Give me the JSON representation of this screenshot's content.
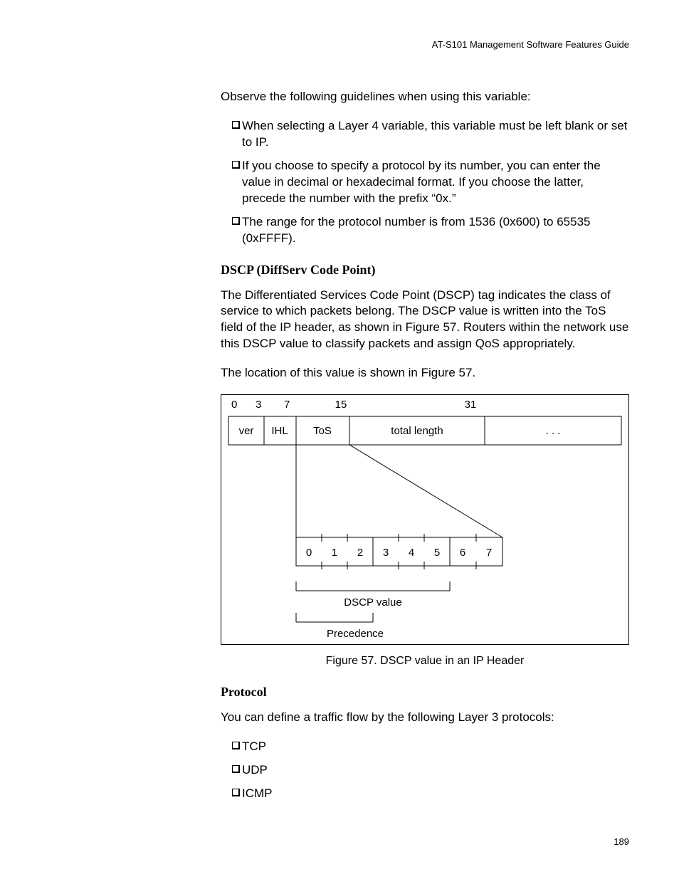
{
  "header": {
    "guide_title": "AT-S101 Management Software Features Guide"
  },
  "intro": "Observe the following guidelines when using this variable:",
  "guidelines": [
    "When selecting a Layer 4 variable, this variable must be left blank or set to IP.",
    "If you choose to specify a protocol by its number, you can enter the value in decimal or hexadecimal format. If you choose the latter, precede the number with the prefix “0x.”",
    "The range for the protocol number is from 1536 (0x600) to 65535 (0xFFFF)."
  ],
  "dscp": {
    "heading": "DSCP (DiffServ Code Point)",
    "paragraph1": "The Differentiated Services Code Point (DSCP) tag indicates the class of service to which packets belong. The DSCP value is written into the ToS field of the IP header, as shown in Figure 57. Routers within the network use this DSCP value to classify packets and assign QoS appropriately.",
    "paragraph2": "The location of this value is shown in Figure 57."
  },
  "figure": {
    "caption": "Figure 57. DSCP value in an IP Header",
    "top_labels": {
      "l0": "0",
      "l3": "3",
      "l7": "7",
      "l15": "15",
      "l31": "31"
    },
    "fields": {
      "ver": "ver",
      "ihl": "IHL",
      "tos": "ToS",
      "total_length": "total length",
      "dots": ". . ."
    },
    "bit_labels": [
      "0",
      "1",
      "2",
      "3",
      "4",
      "5",
      "6",
      "7"
    ],
    "dscp_label": "DSCP value",
    "precedence_label": "Precedence"
  },
  "protocol": {
    "heading": "Protocol",
    "intro": "You can define a traffic flow by the following Layer 3 protocols:",
    "items": [
      "TCP",
      "UDP",
      "ICMP"
    ]
  },
  "page_number": "189"
}
